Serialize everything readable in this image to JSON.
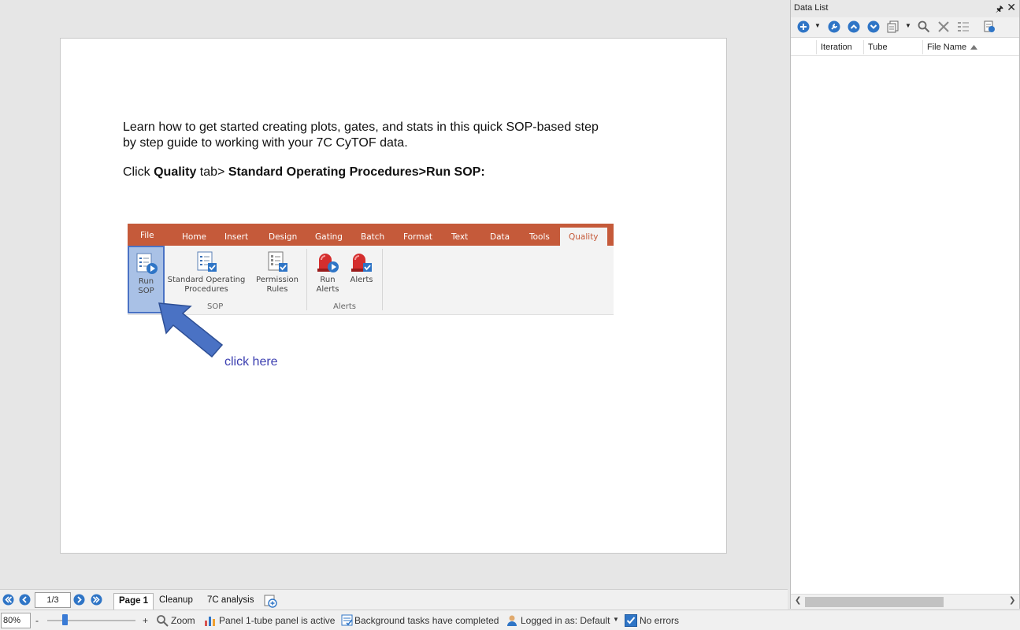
{
  "document": {
    "intro_line1": "Learn how to get started creating plots, gates, and stats in this quick SOP-based step",
    "intro_line2": "by step guide to working with your 7C CyTOF data.",
    "instruction_prefix": "Click ",
    "instruction_quality": "Quality",
    "instruction_middle": " tab> ",
    "instruction_path": "Standard Operating Procedures>Run SOP:",
    "callout": "click here"
  },
  "ribbon": {
    "tabs": [
      "File",
      "Home",
      "Insert",
      "Design",
      "Gating",
      "Batch",
      "Format",
      "Text",
      "Data",
      "Tools",
      "Quality"
    ],
    "active_tab": "Quality",
    "buttons": {
      "run_sop_l1": "Run",
      "run_sop_l2": "SOP",
      "sop_l1": "Standard Operating",
      "sop_l2": "Procedures",
      "perm_l1": "Permission",
      "perm_l2": "Rules",
      "run_alerts_l1": "Run",
      "run_alerts_l2": "Alerts",
      "alerts": "Alerts"
    },
    "groups": {
      "sop": "SOP",
      "alerts": "Alerts"
    }
  },
  "data_list": {
    "title": "Data List",
    "columns": [
      "Iteration",
      "Tube",
      "File Name"
    ],
    "sorted_column": "File Name"
  },
  "page_nav": {
    "page_value": "1/3",
    "tabs": [
      "Page 1",
      "Cleanup",
      "7C analysis"
    ],
    "active_tab": "Page 1"
  },
  "status": {
    "zoom_value": "80%",
    "zoom_minus": "-",
    "zoom_plus": "+",
    "zoom_label": "Zoom",
    "panel": "Panel 1-tube panel is active",
    "background": "Background tasks have completed",
    "logged_in": "Logged in as: Default",
    "errors": "No errors"
  },
  "colors": {
    "ribbon_accent": "#c55a3a",
    "nav_blue": "#2f75c6",
    "callout_blue": "#3b3eb0",
    "arrow_fill": "#4a72c4"
  }
}
